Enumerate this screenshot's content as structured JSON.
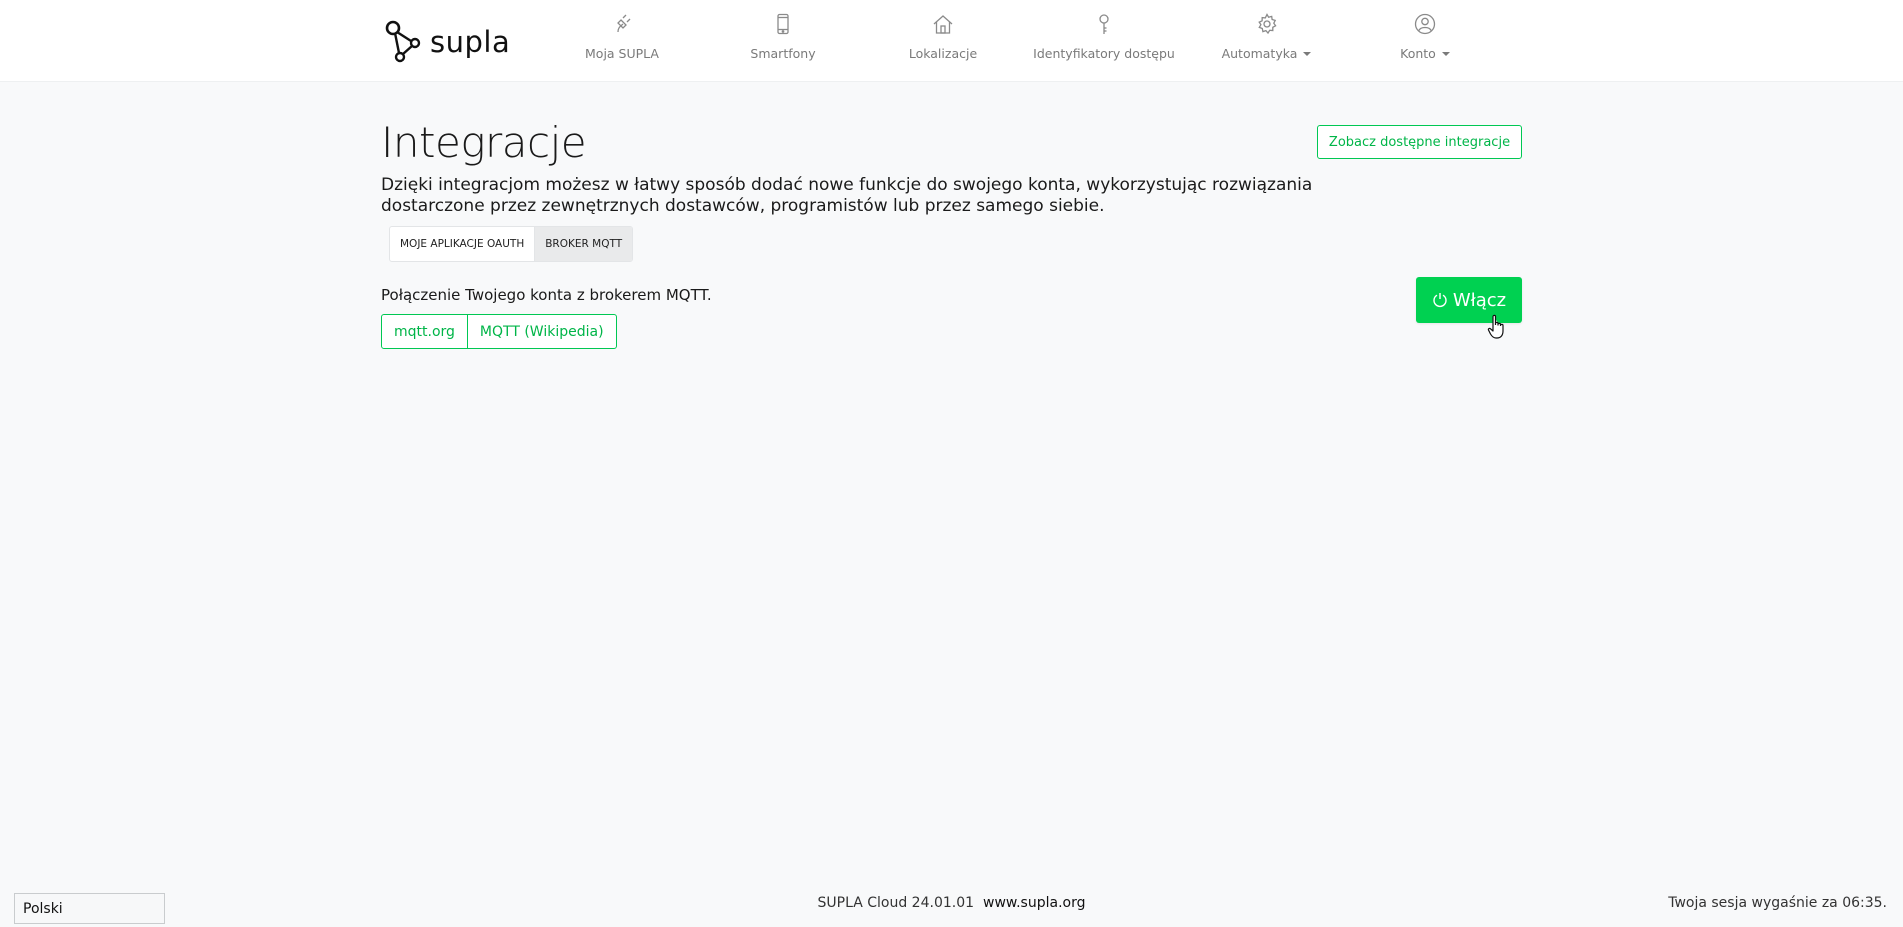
{
  "brand": {
    "name": "supla"
  },
  "nav": {
    "items": [
      {
        "label": "Moja SUPLA",
        "icon": "plug-icon"
      },
      {
        "label": "Smartfony",
        "icon": "smartphone-icon"
      },
      {
        "label": "Lokalizacje",
        "icon": "home-icon"
      },
      {
        "label": "Identyfikatory dostępu",
        "icon": "key-icon"
      },
      {
        "label": "Automatyka",
        "icon": "gear-icon",
        "dropdown": true
      },
      {
        "label": "Konto",
        "icon": "user-icon",
        "dropdown": true
      }
    ]
  },
  "main": {
    "title": "Integracje",
    "see_integrations_label": "Zobacz dostępne integracje",
    "description": "Dzięki integracjom możesz w łatwy sposób dodać nowe funkcje do swojego konta, wykorzystując rozwiązania dostarczone przez zewnętrznych dostawców, programistów lub przez samego siebie.",
    "tabs": [
      {
        "label": "MOJE APLIKACJE OAUTH",
        "active": false
      },
      {
        "label": "BROKER MQTT",
        "active": true
      }
    ],
    "mqtt": {
      "description": "Połączenie Twojego konta z brokerem MQTT.",
      "links": [
        {
          "label": "mqtt.org"
        },
        {
          "label": "MQTT (Wikipedia)"
        }
      ],
      "enable_label": "Włącz"
    }
  },
  "footer": {
    "language": "Polski",
    "version": "SUPLA Cloud 24.01.01",
    "site": "www.supla.org",
    "session": "Twoja sesja wygaśnie za 06:35."
  },
  "colors": {
    "accent": "#00d151",
    "accent_text": "#00b548",
    "nav_text": "#7a7a7a",
    "background": "#f8f9fa"
  }
}
